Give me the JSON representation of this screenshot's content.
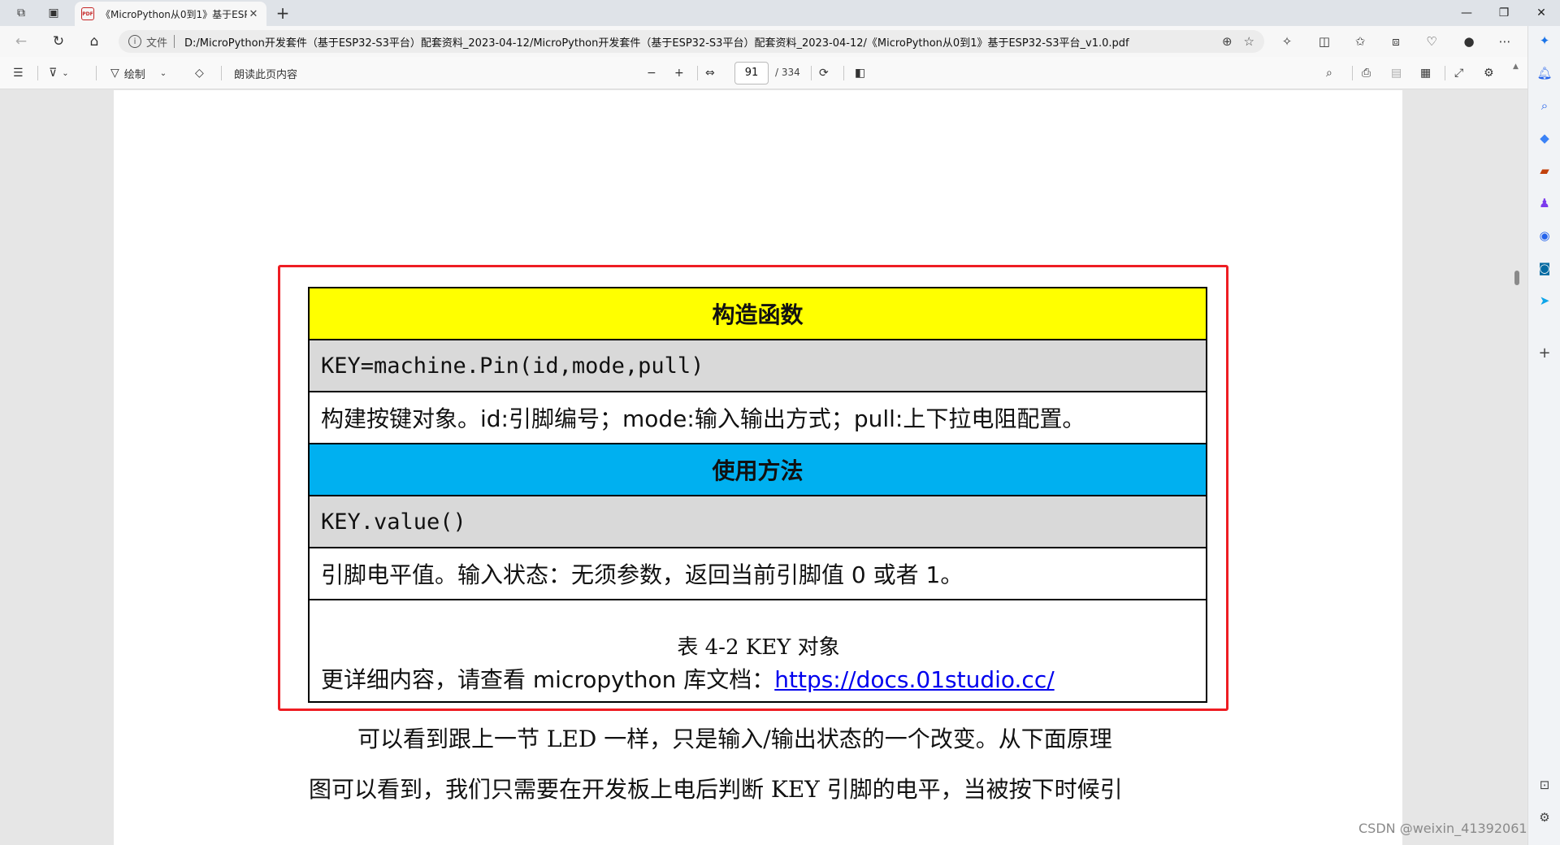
{
  "browser": {
    "tab": {
      "title": "《MicroPython从0到1》基于ESP",
      "badge": "PDF",
      "close": "✕"
    },
    "new_tab": "+",
    "window": {
      "minimize": "—",
      "restore": "❐",
      "close": "✕"
    },
    "address": {
      "scheme_label": "文件",
      "url": "D:/MicroPython开发套件（基于ESP32-S3平台）配套资料_2023-04-12/MicroPython开发套件（基于ESP32-S3平台）配套资料_2023-04-12/《MicroPython从0到1》基于ESP32-S3平台_v1.0.pdf"
    }
  },
  "pdf_toolbar": {
    "draw_label": "绘制",
    "read_aloud_label": "朗读此页内容",
    "current_page": "91",
    "total_pages": "/ 334"
  },
  "document": {
    "table": {
      "constructor_header": "构造函数",
      "constructor_code": "KEY=machine.Pin(id,mode,pull)",
      "constructor_desc": "构建按键对象。id:引脚编号；mode:输入输出方式；pull:上下拉电阻配置。",
      "methods_header": "使用方法",
      "method_code": "KEY.value()",
      "method_desc": "引脚电平值。输入状态：无须参数，返回当前引脚值 0 或者 1。",
      "more_text": "更详细内容，请查看 micropython 库文档：",
      "more_link": "https://docs.01studio.cc/"
    },
    "caption": "表 4-2    KEY 对象",
    "paragraph_line1": "可以看到跟上一节 LED 一样，只是输入/输出状态的一个改变。从下面原理",
    "paragraph_line2": "图可以看到，我们只需要在开发板上电后判断 KEY 引脚的电平，当被按下时候引"
  },
  "watermark": "CSDN @weixin_41392061",
  "colors": {
    "header_yellow": "#ffff00",
    "header_blue": "#00b0f0",
    "row_gray": "#d9d9d9",
    "highlight_red": "#ee1d23",
    "link_blue": "#0000ee"
  }
}
